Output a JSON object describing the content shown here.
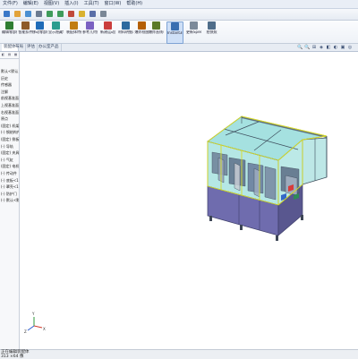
{
  "menu": [
    "文件(F)",
    "编辑(E)",
    "视图(V)",
    "插入(I)",
    "工具(T)",
    "窗口(W)",
    "帮助(H)"
  ],
  "quick_toolbar_icons": [
    "new-icon",
    "open-icon",
    "save-icon",
    "print-icon",
    "undo-icon",
    "redo-icon",
    "select-icon",
    "rebuild-icon",
    "file-properties-icon",
    "options-icon"
  ],
  "ribbon": {
    "buttons": [
      {
        "label": "编辑零部件",
        "icon": "edit-component-icon"
      },
      {
        "label": "智能扣件",
        "icon": "smart-fasteners-icon"
      },
      {
        "label": "移动零部件",
        "icon": "move-component-icon"
      },
      {
        "label": "显示隐藏零部件",
        "icon": "show-hidden-icon"
      },
      {
        "label": "装配体特征",
        "icon": "assembly-features-icon"
      },
      {
        "label": "参考几何体",
        "icon": "reference-geometry-icon"
      },
      {
        "label": "新建运动算例",
        "icon": "motion-study-icon"
      },
      {
        "label": "材料明细表",
        "icon": "bom-icon"
      },
      {
        "label": "爆炸视图",
        "icon": "exploded-view-icon"
      },
      {
        "label": "爆炸直线草图",
        "icon": "explode-line-sketch-icon"
      },
      {
        "label": "Instant3D",
        "icon": "instant3d-icon",
        "selected": true
      },
      {
        "label": "更新Speedpak",
        "icon": "speedpak-icon"
      },
      {
        "label": "拍快照",
        "icon": "snapshot-icon"
      }
    ]
  },
  "tabs": [
    "装配体",
    "布局",
    "评估",
    "办公室产品"
  ],
  "viewport": {
    "view_tools": [
      "🔍",
      "🔍",
      "⊞",
      "◈",
      "◧",
      "◐",
      "▣",
      "◎"
    ],
    "model_colors": {
      "frame": "#4a5a6b",
      "glass": "#79d3d0",
      "edge": "#d9dd25",
      "base": "#7a78b8",
      "legs": "#3e4656"
    },
    "triad_labels": [
      "Y",
      "X",
      "Z"
    ]
  },
  "feature_tree": {
    "items": [
      "默认<默认",
      "历史",
      "传感器",
      "注解",
      "前视基准面",
      "上视基准面",
      "右视基准面",
      "原点",
      "(固定) 机架",
      "(-) 钢结构件",
      "(固定) 侧板",
      "(-) 导轨",
      "(固定) 夹具",
      "(-) 气缸",
      "(固定) 电机",
      "(-) 传动件",
      "(-) 底板<1>",
      "(-) 罩壳<1>",
      "(-) 防护门",
      "(-) 默认<默认>"
    ]
  },
  "status": {
    "line1": "正在编辑装配体",
    "line2": "313 ×64 像"
  }
}
